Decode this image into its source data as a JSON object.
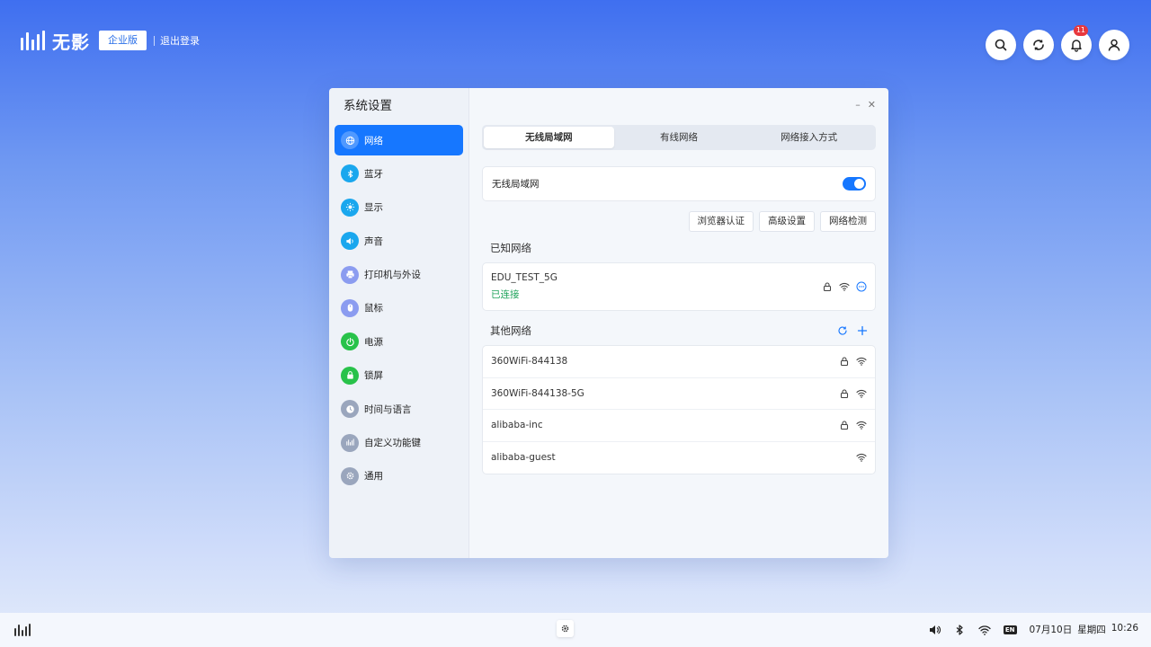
{
  "brand": {
    "name": "无影",
    "edition": "企业版",
    "logout": "退出登录"
  },
  "top_actions": {
    "notification_count": "11"
  },
  "window": {
    "title": "系统设置",
    "minimize": "–",
    "close": "✕",
    "nav": [
      {
        "label": "网络",
        "icon": "globe-icon",
        "color": "#1677ff"
      },
      {
        "label": "蓝牙",
        "icon": "bluetooth-icon",
        "color": "#1aa7ee"
      },
      {
        "label": "显示",
        "icon": "sun-icon",
        "color": "#1aa7ee"
      },
      {
        "label": "声音",
        "icon": "speaker-icon",
        "color": "#1aa7ee"
      },
      {
        "label": "打印机与外设",
        "icon": "printer-icon",
        "color": "#8b9cf0"
      },
      {
        "label": "鼠标",
        "icon": "mouse-icon",
        "color": "#8b9cf0"
      },
      {
        "label": "电源",
        "icon": "power-icon",
        "color": "#28c24a"
      },
      {
        "label": "锁屏",
        "icon": "lock-icon",
        "color": "#28c24a"
      },
      {
        "label": "时间与语言",
        "icon": "clock-icon",
        "color": "#9aa6bd"
      },
      {
        "label": "自定义功能键",
        "icon": "keys-icon",
        "color": "#9aa6bd"
      },
      {
        "label": "通用",
        "icon": "gear-icon",
        "color": "#9aa6bd"
      }
    ],
    "tabs": [
      "无线局域网",
      "有线网络",
      "网络接入方式"
    ],
    "wifi_toggle_label": "无线局域网",
    "wifi_enabled": true,
    "buttons": [
      "浏览器认证",
      "高级设置",
      "网络检测"
    ],
    "known_title": "已知网络",
    "known": {
      "ssid": "EDU_TEST_5G",
      "status": "已连接"
    },
    "other_title": "其他网络",
    "others": [
      {
        "ssid": "360WiFi-844138",
        "locked": true
      },
      {
        "ssid": "360WiFi-844138-5G",
        "locked": true
      },
      {
        "ssid": "alibaba-inc",
        "locked": true
      },
      {
        "ssid": "alibaba-guest",
        "locked": false
      }
    ]
  },
  "taskbar": {
    "date": "07月10日",
    "weekday": "星期四",
    "time": "10:26",
    "ime": "EN"
  }
}
